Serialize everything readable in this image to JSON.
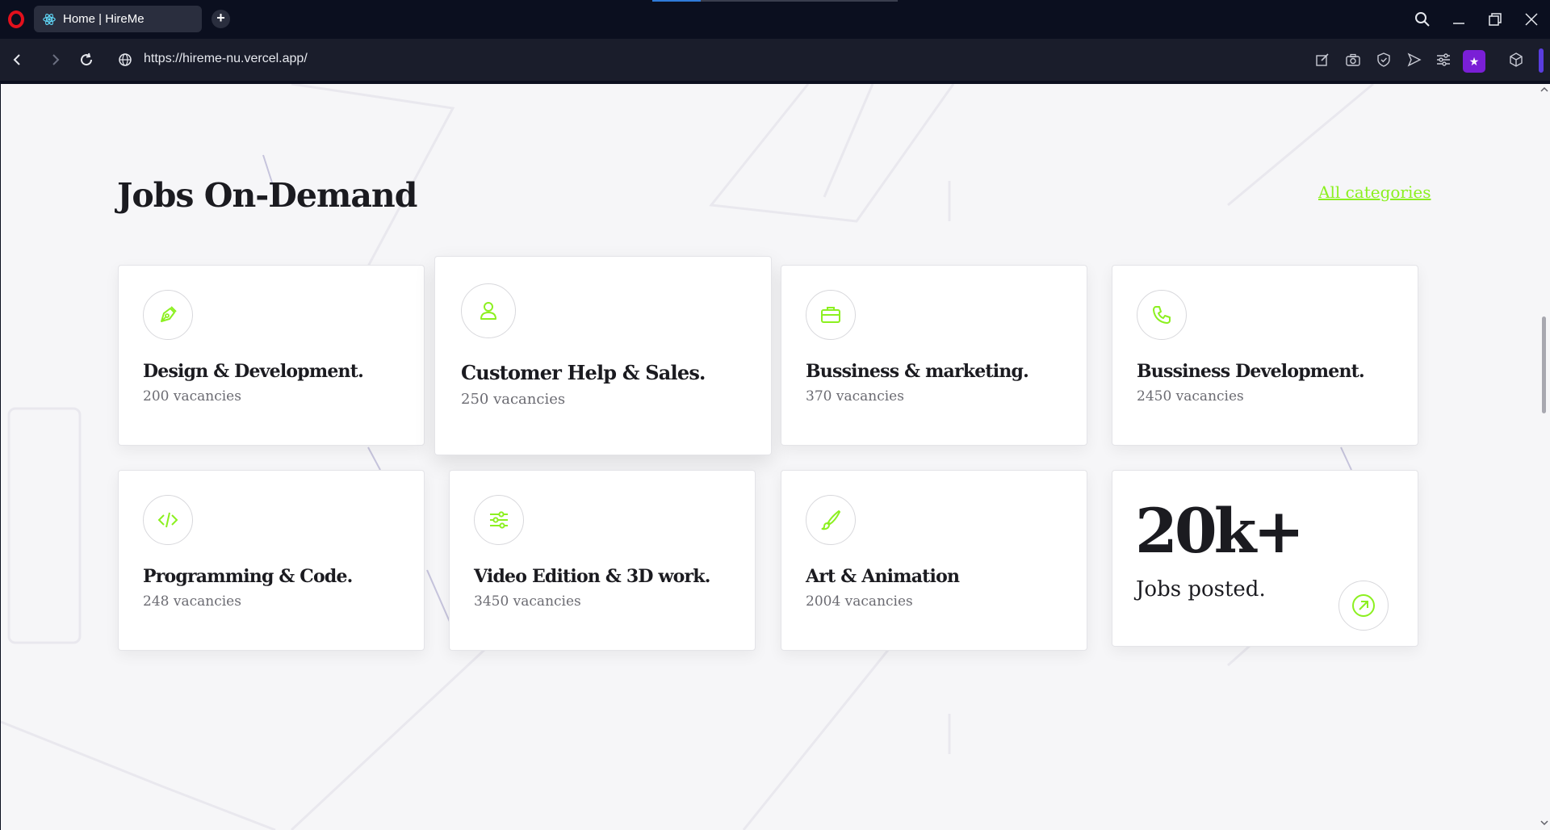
{
  "browser": {
    "tab_title": "Home | HireMe",
    "url": "https://hireme-nu.vercel.app/"
  },
  "colors": {
    "accent": "#8cf020",
    "heading": "#1b1b20",
    "muted": "#6b6b72",
    "chrome_bg": "#0b0f1f"
  },
  "section": {
    "title": "Jobs On-Demand",
    "all_categories": "All categories"
  },
  "categories": [
    {
      "title": "Design & Development.",
      "vacancies": "200 vacancies",
      "icon": "pen-nib-icon"
    },
    {
      "title": "Customer Help & Sales.",
      "vacancies": "250 vacancies",
      "icon": "user-icon"
    },
    {
      "title": "Bussiness & marketing.",
      "vacancies": "370 vacancies",
      "icon": "briefcase-icon"
    },
    {
      "title": "Bussiness Development.",
      "vacancies": "2450 vacancies",
      "icon": "phone-icon"
    },
    {
      "title": "Programming & Code.",
      "vacancies": "248 vacancies",
      "icon": "code-icon"
    },
    {
      "title": "Video Edition & 3D work.",
      "vacancies": "3450 vacancies",
      "icon": "sliders-icon"
    },
    {
      "title": "Art & Animation",
      "vacancies": "2004 vacancies",
      "icon": "brush-icon"
    }
  ],
  "stats": {
    "number": "20k+",
    "label": "Jobs posted."
  }
}
